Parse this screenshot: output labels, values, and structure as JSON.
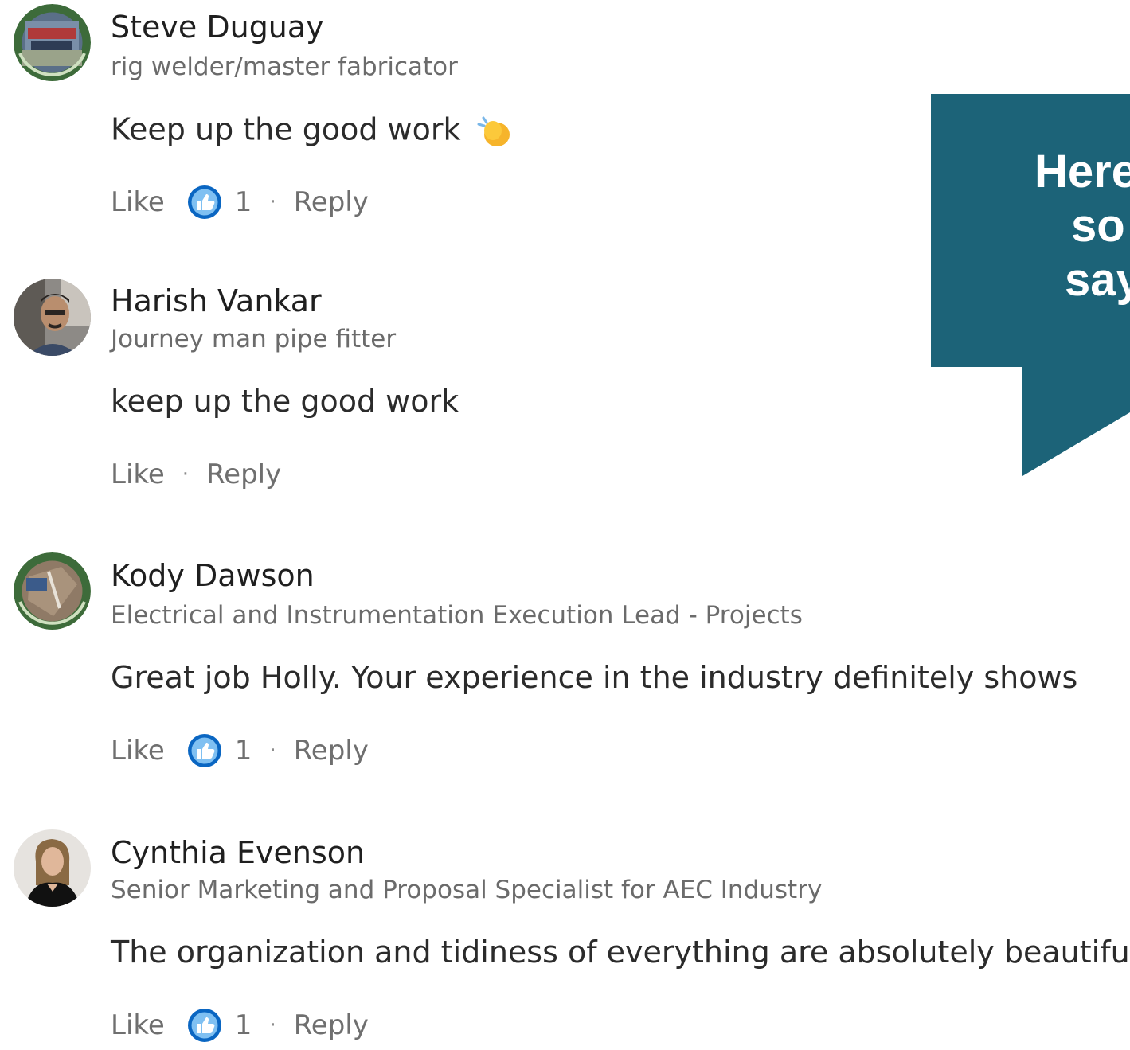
{
  "comments": [
    {
      "name": "Steve Duguay",
      "headline": "rig welder/master fabricator",
      "text": "Keep up the good work",
      "emoji": "clapping-hands",
      "like_label": "Like",
      "reaction_count": "1",
      "reply_label": "Reply",
      "separator": "·"
    },
    {
      "name": "Harish Vankar",
      "headline": "Journey man pipe fitter",
      "text": "keep up the good work",
      "like_label": "Like",
      "reply_label": "Reply",
      "separator": "·"
    },
    {
      "name": "Kody Dawson",
      "headline": "Electrical and Instrumentation Execution Lead - Projects",
      "text": "Great job Holly. Your experience in the industry definitely shows",
      "like_label": "Like",
      "reaction_count": "1",
      "reply_label": "Reply",
      "separator": "·"
    },
    {
      "name": "Cynthia Evenson",
      "headline": "Senior Marketing and Proposal Specialist for AEC Industry",
      "text": "The organization and tidiness of everything are absolutely beautiful!",
      "like_label": "Like",
      "reaction_count": "1",
      "reply_label": "Reply",
      "separator": "·"
    }
  ],
  "callout": {
    "lines": [
      "Here",
      "so",
      "say"
    ],
    "color": "#1c6378"
  },
  "colors": {
    "like_blue": "#0a66c2",
    "name": "#1f1f1f",
    "headline": "#6b6b6b",
    "action": "#6f6f6f"
  }
}
